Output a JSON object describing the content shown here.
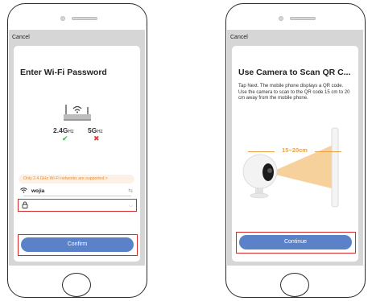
{
  "left_screen": {
    "cancel_label": "Cancel",
    "title": "Enter Wi-Fi Password",
    "band_24_main": "2.4G",
    "band_24_sub": "Hz",
    "band_5_main": "5G",
    "band_5_sub": "Hz",
    "band_24_status_icon": "check-icon",
    "band_5_status_icon": "cross-icon",
    "notice": "Only 2.4 GHz Wi-Fi networks are supported >",
    "wifi_ssid": "wojia",
    "password_value": "",
    "confirm_label": "Confirm",
    "colors": {
      "accent": "#5b82c8",
      "notice_text": "#f08a24",
      "highlight": "#d82a2a",
      "check": "#2db24a",
      "cross": "#e04040"
    }
  },
  "right_screen": {
    "cancel_label": "Cancel",
    "title": "Use Camera to Scan QR C...",
    "description": "Tap Next. The mobile phone displays a QR code. Use the camera to scan to the QR code 15 cm to 20 cm away from the mobile phone.",
    "distance_label": "15~20cm",
    "continue_label": "Continue",
    "colors": {
      "accent": "#5b82c8",
      "beam": "#f5c98a",
      "distance": "#e8a24a"
    }
  }
}
